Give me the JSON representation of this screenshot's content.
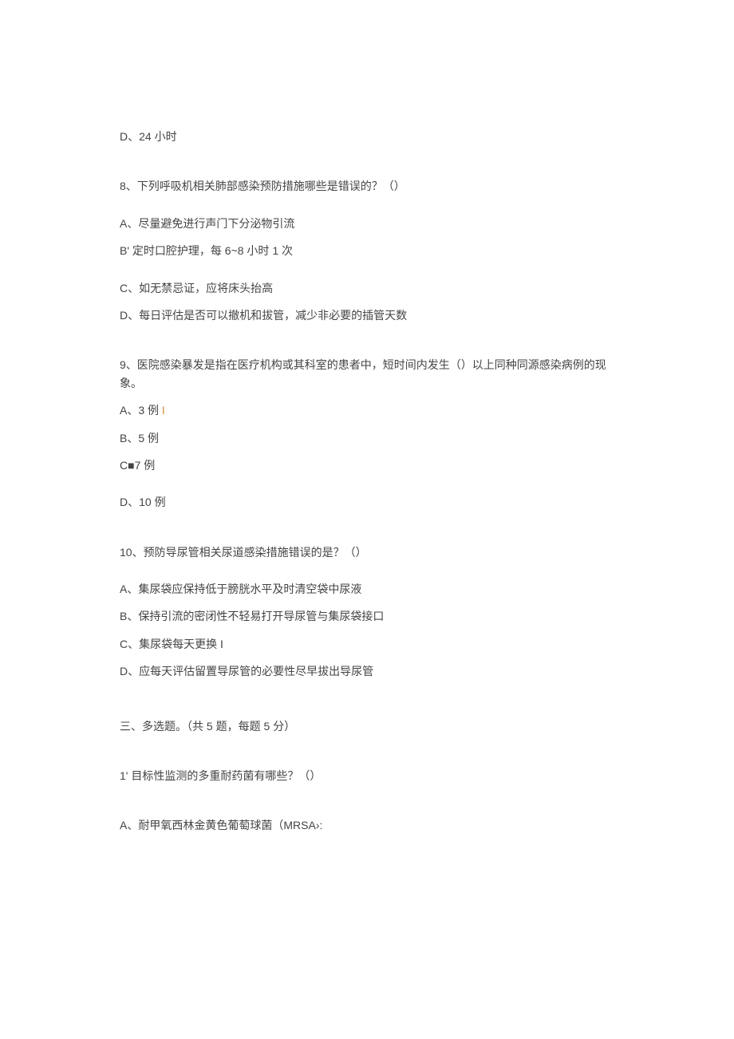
{
  "items": [
    {
      "text": "D、24 小时",
      "cls": "option"
    },
    {
      "text": "8、下列呼吸机相关肺部感染预防措施哪些是错误的？（）",
      "cls": "line question-gap"
    },
    {
      "text": "A、尽量避免进行声门下分泌物引流",
      "cls": "option sub-gap"
    },
    {
      "text": "B' 定时口腔护理，每 6~8 小时 1 次",
      "cls": "option"
    },
    {
      "text": "C、如无禁忌证，应将床头抬高",
      "cls": "option sub-gap"
    },
    {
      "text": "D、每日评估是否可以撤机和拔管，减少非必要的插管天数",
      "cls": "option"
    },
    {
      "text": "9、医院感染暴发是指在医疗机构或其科室的患者中，短时间内发生（）以上同种同源感染病例的现象。",
      "cls": "line question-gap"
    },
    {
      "html": "A、3 例 <span class=\"orange-char\">I</span>",
      "cls": "option"
    },
    {
      "text": "B、5 例",
      "cls": "option"
    },
    {
      "text": "C■7 例",
      "cls": "option"
    },
    {
      "text": "D、10 例",
      "cls": "option sub-gap"
    },
    {
      "text": "10、预防导尿管相关尿道感染措施错误的是？（）",
      "cls": "line question-gap"
    },
    {
      "text": "A、集尿袋应保持低于膀胱水平及时清空袋中尿液",
      "cls": "option sub-gap"
    },
    {
      "text": "B、保持引流的密闭性不轻易打开导尿管与集尿袋接口",
      "cls": "option"
    },
    {
      "text": "C、集尿袋每天更换 I",
      "cls": "option"
    },
    {
      "text": "D、应每天评估留置导尿管的必要性尽早拔出导尿管",
      "cls": "option"
    },
    {
      "text": "三、多选题。（共 5 题，每题 5 分）",
      "cls": "line section-gap"
    },
    {
      "text": "1' 目标性监测的多重耐药菌有哪些？（）",
      "cls": "line question-gap"
    },
    {
      "text": "A、耐甲氧西林金黄色葡萄球菌（MRSA›:",
      "cls": "option question-gap"
    }
  ]
}
